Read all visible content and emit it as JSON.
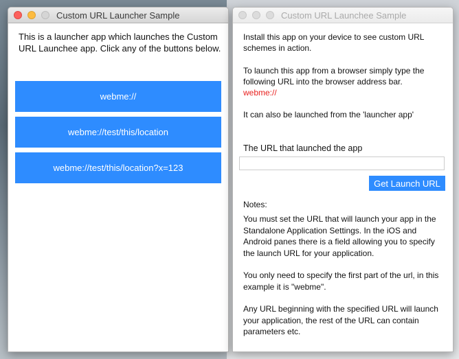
{
  "left_window": {
    "title": "Custom URL Launcher Sample",
    "intro": "This is a launcher app which launches the Custom URL Launchee app. Click any of the buttons below.",
    "buttons": [
      "webme://",
      "webme://test/this/location",
      "webme://test/this/location?x=123"
    ],
    "accent_color": "#2e8cff"
  },
  "right_window": {
    "title": "Custom URL Launchee Sample",
    "p1": "Install this app on your device to see custom URL schemes in action.",
    "p2": "To launch this app from a browser simply type the following URL into the browser address bar.",
    "p2_url": "webme://",
    "p3": "It can also be launched from the 'launcher app'",
    "url_label": "The URL that launched the app",
    "url_value": "",
    "get_button": "Get Launch URL",
    "notes_label": "Notes:",
    "notes": [
      "You must set the URL that will launch your app in the Standalone Application Settings. In the iOS and Android panes there is a field allowing you to specify the launch URL for your application.",
      "You only need to specify the first part of the url, in this example it is \"webme\".",
      "Any URL beginning with the specified URL will launch your application, the rest of the URL can contain parameters etc."
    ],
    "url_color": "#e8211f"
  }
}
